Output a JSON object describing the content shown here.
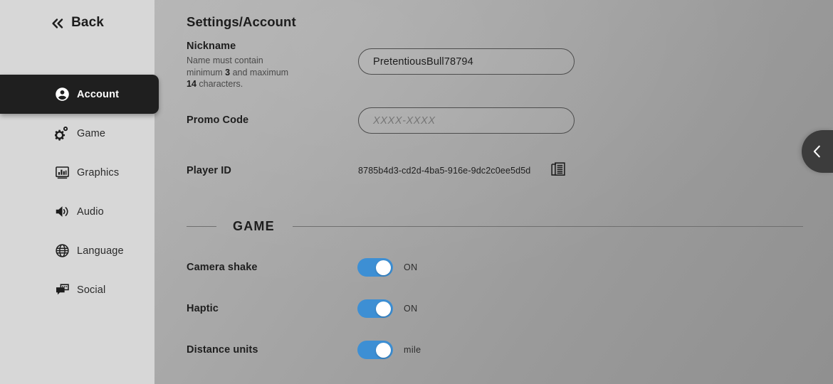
{
  "sidebar": {
    "back": {
      "label": "Back",
      "icon": "double-chevron-left-icon"
    },
    "items": [
      {
        "label": "Account",
        "icon": "account-icon",
        "active": true
      },
      {
        "label": "Game",
        "icon": "gears-icon",
        "active": false
      },
      {
        "label": "Graphics",
        "icon": "bar-chart-icon",
        "active": false
      },
      {
        "label": "Audio",
        "icon": "speaker-icon",
        "active": false
      },
      {
        "label": "Language",
        "icon": "globe-icon",
        "active": false
      },
      {
        "label": "Social",
        "icon": "chat-icon",
        "active": false
      }
    ]
  },
  "main": {
    "title": "Settings/Account",
    "nickname": {
      "label": "Nickname",
      "hint_prefix": "Name must contain minimum ",
      "hint_min": "3",
      "hint_mid": " and maximum ",
      "hint_max": "14",
      "hint_suffix": " characters.",
      "value": "PretentiousBull78794"
    },
    "promo": {
      "label": "Promo Code",
      "placeholder": "XXXX-XXXX",
      "value": ""
    },
    "player_id": {
      "label": "Player ID",
      "value": "8785b4d3-cd2d-4ba5-916e-9dc2c0ee5d5d",
      "copy_icon": "copy-icon"
    },
    "game_section": {
      "title": "GAME",
      "rows": [
        {
          "label": "Camera shake",
          "state": "ON",
          "on": true
        },
        {
          "label": "Haptic",
          "state": "ON",
          "on": true
        },
        {
          "label": "Distance units",
          "state": "mile",
          "on": true
        }
      ]
    }
  },
  "edge_tab": {
    "icon": "chevron-left-icon"
  },
  "colors": {
    "accent": "#3d8fd4",
    "sidebar_bg": "#d7d7d7",
    "active_item_bg": "#1f1f1f",
    "edge_tab_bg": "#3c3c3c",
    "text_primary": "#1d1d1d"
  }
}
